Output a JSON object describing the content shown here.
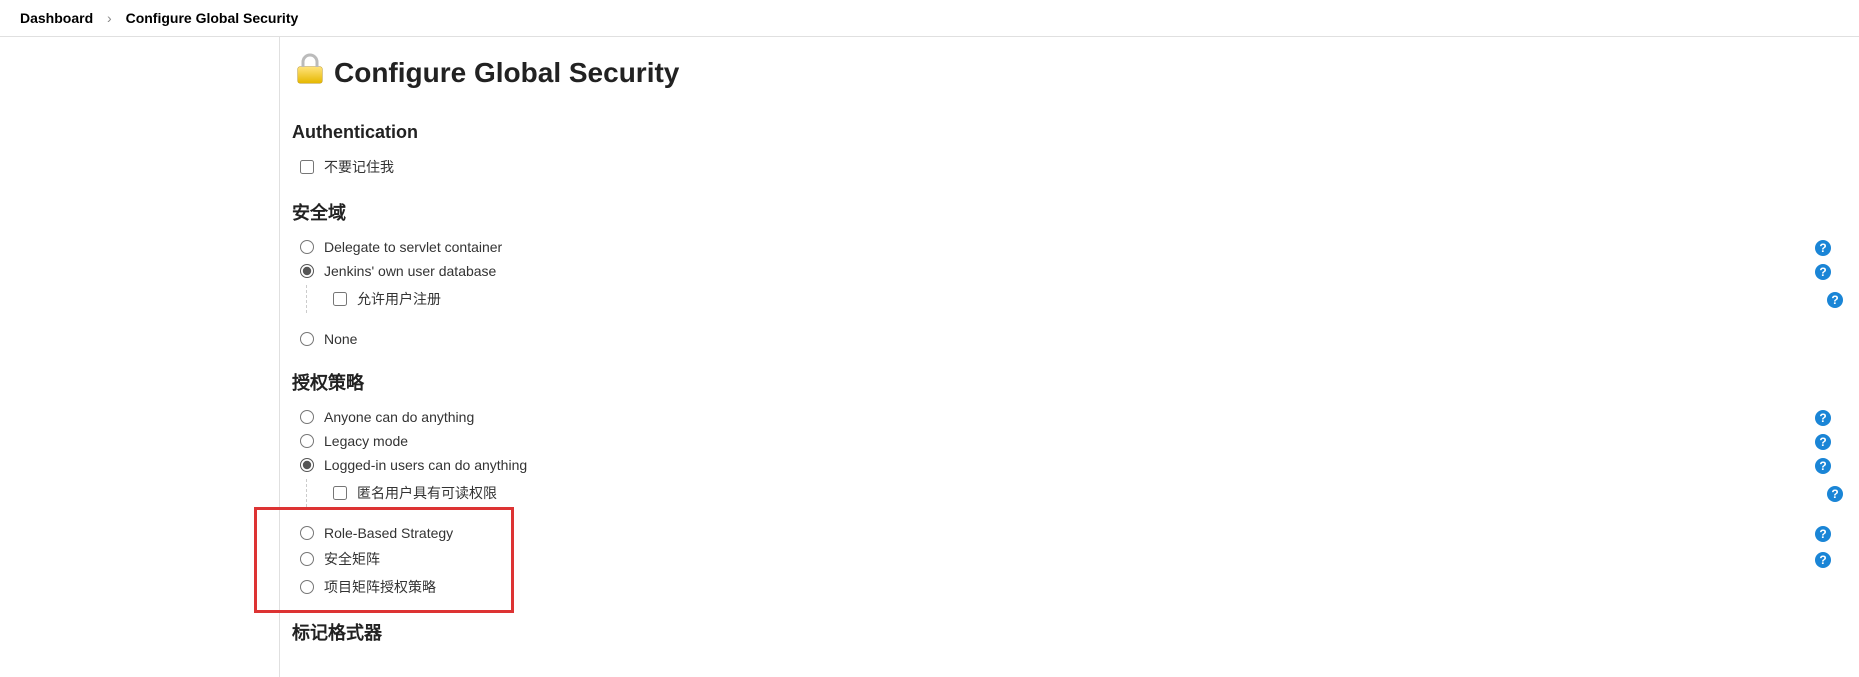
{
  "breadcrumb": {
    "dashboard": "Dashboard",
    "current": "Configure Global Security"
  },
  "page_title": "Configure Global Security",
  "sections": {
    "authentication": {
      "heading": "Authentication",
      "remember_me": "不要记住我"
    },
    "security_realm": {
      "heading": "安全域",
      "delegate": "Delegate to servlet container",
      "own_db": "Jenkins' own user database",
      "allow_signup": "允许用户注册",
      "none": "None"
    },
    "authorization": {
      "heading": "授权策略",
      "anyone": "Anyone can do anything",
      "legacy": "Legacy mode",
      "logged_in": "Logged-in users can do anything",
      "anon_read": "匿名用户具有可读权限",
      "role_based": "Role-Based Strategy",
      "matrix": "安全矩阵",
      "project_matrix": "项目矩阵授权策略"
    },
    "markup": {
      "heading": "标记格式器"
    }
  },
  "help_tooltip": "?"
}
